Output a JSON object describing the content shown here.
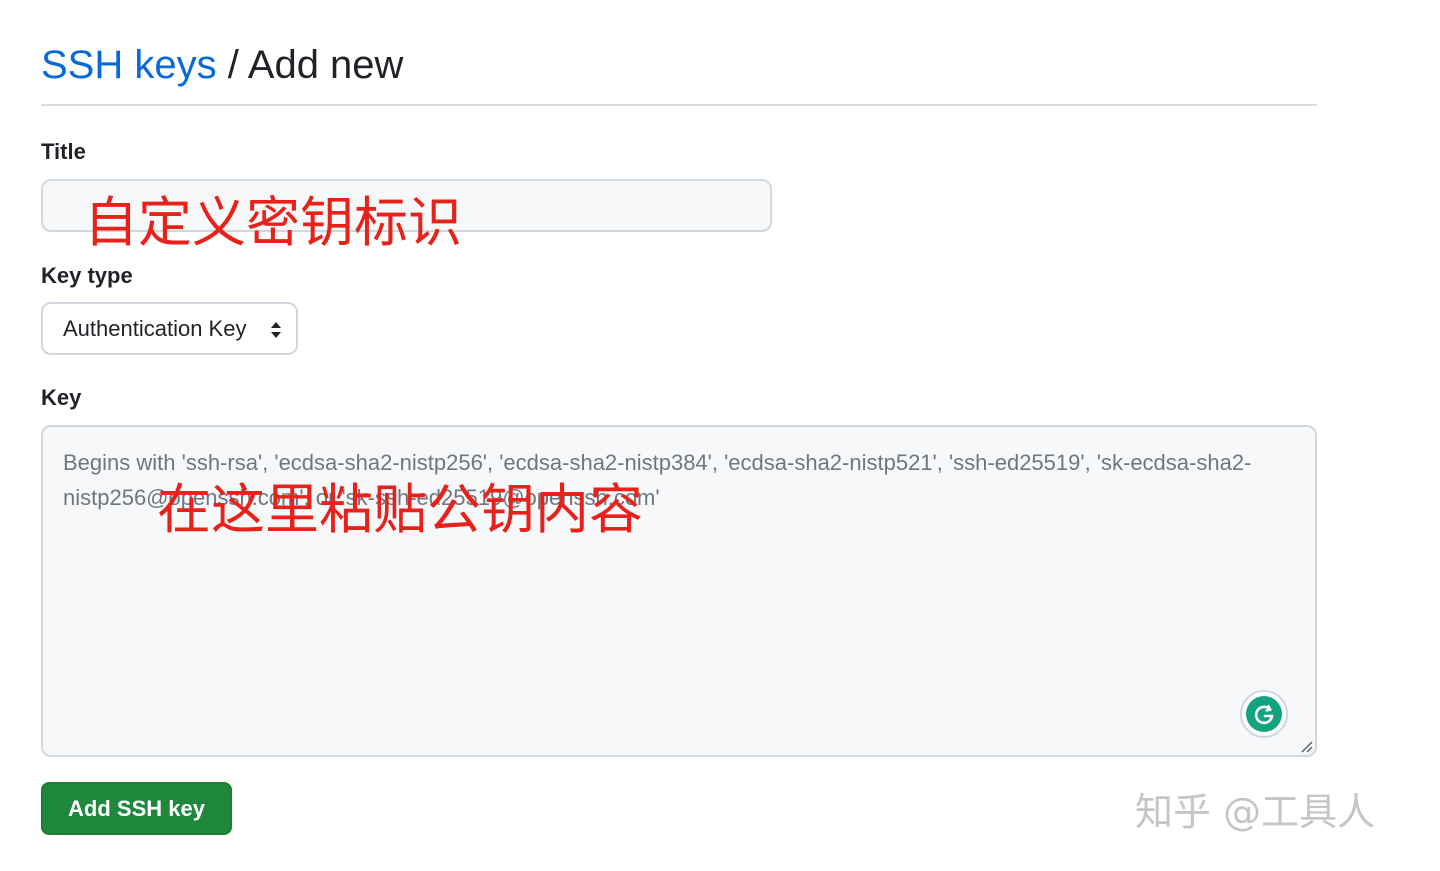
{
  "header": {
    "breadcrumb_link": "SSH keys",
    "separator": "/",
    "current": "Add new"
  },
  "form": {
    "title_label": "Title",
    "title_value": "",
    "key_type_label": "Key type",
    "key_type_selected": "Authentication Key",
    "key_label": "Key",
    "key_placeholder": "Begins with 'ssh-rsa', 'ecdsa-sha2-nistp256', 'ecdsa-sha2-nistp384', 'ecdsa-sha2-nistp521', 'ssh-ed25519', 'sk-ecdsa-sha2-nistp256@openssh.com', or 'sk-ssh-ed25519@openssh.com'",
    "submit_label": "Add SSH key"
  },
  "annotations": {
    "title_note": "自定义密钥标识",
    "key_note": "在这里粘贴公钥内容"
  },
  "watermark": "知乎 @工具人",
  "colors": {
    "link": "#0969da",
    "primary_button": "#1f883d",
    "annotation": "#e8211a",
    "grammarly": "#15a37f"
  },
  "icons": {
    "select_arrows": "chevron-up-down-icon",
    "grammarly": "grammarly-icon",
    "resize": "resize-handle-icon"
  }
}
